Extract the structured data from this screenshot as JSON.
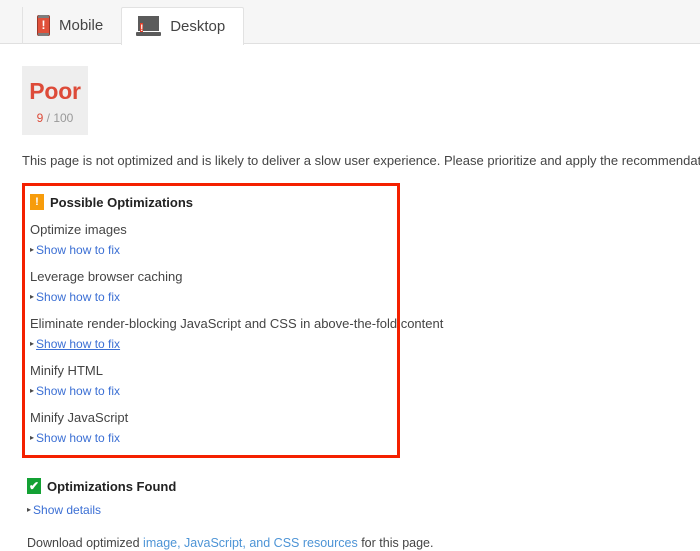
{
  "tabs": [
    {
      "id": "mobile",
      "label": "Mobile",
      "icon": "phone-warning-icon",
      "active": false
    },
    {
      "id": "desktop",
      "label": "Desktop",
      "icon": "laptop-warning-icon",
      "active": true
    }
  ],
  "score": {
    "grade": "Poor",
    "value": "9",
    "separator": " / ",
    "max": "100",
    "grade_color": "#dd4b39",
    "background": "#eeeeee"
  },
  "intro_text": "This page is not optimized and is likely to deliver a slow user experience. Please prioritize and apply the recommendations below.",
  "highlight": {
    "border_color": "#f42000"
  },
  "possible_optimizations": {
    "icon": "warning-exclamation-icon",
    "icon_glyph": "!",
    "icon_color": "#f79c0b",
    "title": "Possible Optimizations",
    "rules": [
      {
        "title": "Optimize images",
        "link": "Show how to fix",
        "hovered": false
      },
      {
        "title": "Leverage browser caching",
        "link": "Show how to fix",
        "hovered": false
      },
      {
        "title": "Eliminate render-blocking JavaScript and CSS in above-the-fold content",
        "link": "Show how to fix",
        "hovered": true
      },
      {
        "title": "Minify HTML",
        "link": "Show how to fix",
        "hovered": false
      },
      {
        "title": "Minify JavaScript",
        "link": "Show how to fix",
        "hovered": false
      }
    ]
  },
  "optimizations_found": {
    "icon": "green-check-icon",
    "icon_glyph": "✔",
    "icon_color": "#13a134",
    "title": "Optimizations Found",
    "link": "Show details"
  },
  "download": {
    "prefix": "Download optimized ",
    "link": "image, JavaScript, and CSS resources",
    "suffix": " for this page.",
    "link_color": "#4d94d6"
  },
  "caret_glyph": "▸"
}
